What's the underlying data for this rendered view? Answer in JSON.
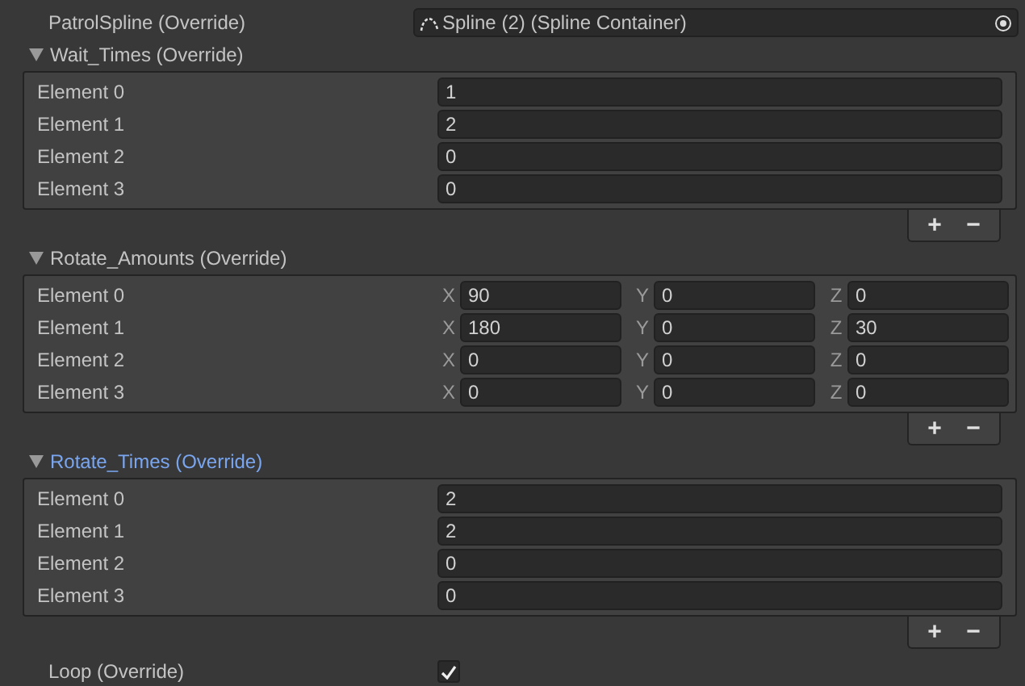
{
  "object_field": {
    "label": "PatrolSpline (Override)",
    "value": "Spline (2) (Spline Container)"
  },
  "lists": [
    {
      "title": "Wait_Times (Override)",
      "kind": "scalar",
      "expanded": true,
      "focused": false,
      "items": [
        {
          "label": "Element 0",
          "value": "1"
        },
        {
          "label": "Element 1",
          "value": "2"
        },
        {
          "label": "Element 2",
          "value": "0"
        },
        {
          "label": "Element 3",
          "value": "0"
        }
      ],
      "add": "+",
      "remove": "−"
    },
    {
      "title": "Rotate_Amounts (Override)",
      "kind": "vector",
      "expanded": true,
      "focused": false,
      "items": [
        {
          "label": "Element 0",
          "components": [
            {
              "axis": "X",
              "value": "90"
            },
            {
              "axis": "Y",
              "value": "0"
            },
            {
              "axis": "Z",
              "value": "0"
            }
          ]
        },
        {
          "label": "Element 1",
          "components": [
            {
              "axis": "X",
              "value": "180"
            },
            {
              "axis": "Y",
              "value": "0"
            },
            {
              "axis": "Z",
              "value": "30"
            }
          ]
        },
        {
          "label": "Element 2",
          "components": [
            {
              "axis": "X",
              "value": "0"
            },
            {
              "axis": "Y",
              "value": "0"
            },
            {
              "axis": "Z",
              "value": "0"
            }
          ]
        },
        {
          "label": "Element 3",
          "components": [
            {
              "axis": "X",
              "value": "0"
            },
            {
              "axis": "Y",
              "value": "0"
            },
            {
              "axis": "Z",
              "value": "0"
            }
          ]
        }
      ],
      "add": "+",
      "remove": "−"
    },
    {
      "title": "Rotate_Times (Override)",
      "kind": "scalar",
      "expanded": true,
      "focused": true,
      "items": [
        {
          "label": "Element 0",
          "value": "2"
        },
        {
          "label": "Element 1",
          "value": "2"
        },
        {
          "label": "Element 2",
          "value": "0"
        },
        {
          "label": "Element 3",
          "value": "0"
        }
      ],
      "add": "+",
      "remove": "−"
    }
  ],
  "loop": {
    "label": "Loop (Override)",
    "checked": true
  }
}
